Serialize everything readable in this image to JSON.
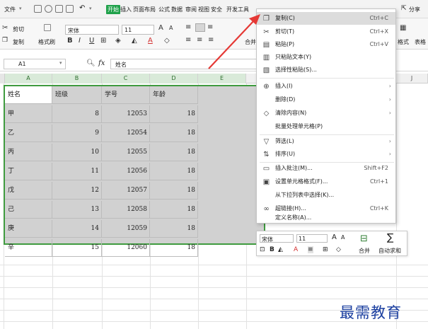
{
  "ribbon_tabs": {
    "file": "文件",
    "start": "开始",
    "insert": "插入",
    "page_layout": "页面布局",
    "formula": "公式",
    "data": "数据",
    "review": "审阅",
    "view": "视图",
    "security": "安全",
    "developer": "开发工具",
    "share": "分享"
  },
  "ribbon": {
    "cut": "剪切",
    "copy": "复制",
    "format_painter": "格式刷",
    "font_name": "宋体",
    "font_size": "11",
    "merge": "合并",
    "cell_format": "格式",
    "table": "表格"
  },
  "formula_bar": {
    "name_box": "A1",
    "content": "姓名"
  },
  "columns": [
    "A",
    "B",
    "C",
    "D",
    "E",
    "J"
  ],
  "table": {
    "headers": [
      "姓名",
      "班级",
      "学号",
      "年龄"
    ],
    "rows": [
      [
        "甲",
        "8",
        "12053",
        "18"
      ],
      [
        "乙",
        "9",
        "12054",
        "18"
      ],
      [
        "丙",
        "10",
        "12055",
        "18"
      ],
      [
        "丁",
        "11",
        "12056",
        "18"
      ],
      [
        "戊",
        "12",
        "12057",
        "18"
      ],
      [
        "己",
        "13",
        "12058",
        "18"
      ],
      [
        "庚",
        "14",
        "12059",
        "18"
      ],
      [
        "辛",
        "15",
        "12060",
        "18"
      ]
    ]
  },
  "context_menu": {
    "items": [
      {
        "label": "复制(C)",
        "shortcut": "Ctrl+C",
        "icon": "copy-icon"
      },
      {
        "label": "剪切(T)",
        "shortcut": "Ctrl+X",
        "icon": "scissors-icon"
      },
      {
        "label": "粘贴(P)",
        "shortcut": "Ctrl+V",
        "icon": "paste-icon"
      },
      {
        "label": "只粘贴文本(Y)",
        "shortcut": "",
        "icon": "paste-text-icon"
      },
      {
        "label": "选择性粘贴(S)...",
        "shortcut": "",
        "icon": "paste-special-icon"
      },
      {
        "label": "插入(I)",
        "shortcut": "",
        "icon": "insert-icon"
      },
      {
        "label": "删除(D)",
        "shortcut": "",
        "icon": ""
      },
      {
        "label": "清除内容(N)",
        "shortcut": "",
        "icon": "eraser-icon"
      },
      {
        "label": "批量处理单元格(P)",
        "shortcut": "",
        "icon": ""
      },
      {
        "label": "筛选(L)",
        "shortcut": "",
        "icon": "filter-icon"
      },
      {
        "label": "排序(U)",
        "shortcut": "",
        "icon": "sort-icon"
      },
      {
        "label": "插入批注(M)...",
        "shortcut": "Shift+F2",
        "icon": "comment-icon"
      },
      {
        "label": "设置单元格格式(F)...",
        "shortcut": "Ctrl+1",
        "icon": "format-cells-icon"
      },
      {
        "label": "从下拉列表中选择(K)...",
        "shortcut": "",
        "icon": ""
      },
      {
        "label": "超链接(H)...",
        "shortcut": "Ctrl+K",
        "icon": "link-icon"
      },
      {
        "label": "定义名称(A)...",
        "shortcut": "",
        "icon": ""
      }
    ]
  },
  "mini_toolbar": {
    "font_name": "宋体",
    "font_size": "11",
    "merge": "合并",
    "autosum": "自动求和"
  },
  "watermark": "最需教育",
  "colors": {
    "accent_green": "#1fa14a",
    "selection_border": "#3f9b3f",
    "arrow_red": "#e53935",
    "watermark_blue": "#1b3fa0"
  }
}
